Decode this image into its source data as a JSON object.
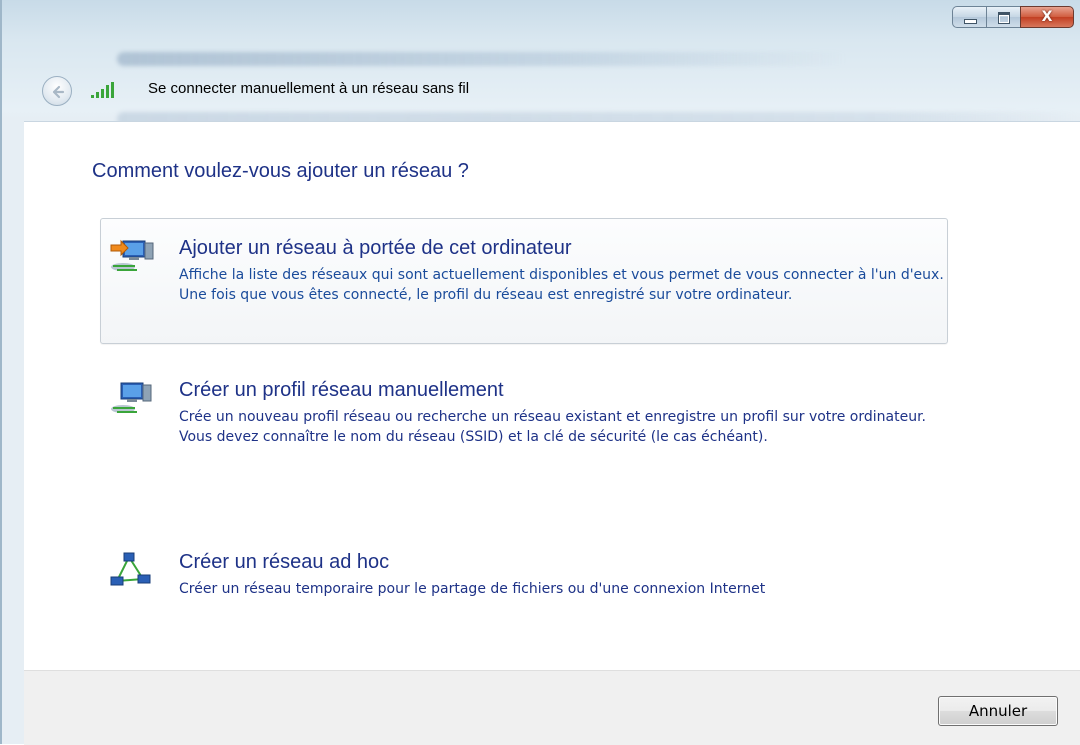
{
  "window": {
    "title": "Se connecter manuellement à un réseau sans fil",
    "controls": [
      "minimize-icon",
      "maximize-icon",
      "close-icon"
    ],
    "close_glyph": "X"
  },
  "main": {
    "heading": "Comment voulez-vous ajouter un réseau ?",
    "options": [
      {
        "title": "Ajouter un réseau à portée de cet ordinateur",
        "description": "Affiche la liste des réseaux qui sont actuellement disponibles et vous permet de vous connecter à l'un d'eux. Une fois que vous êtes connecté, le profil du réseau est enregistré sur votre ordinateur.",
        "icon": "network-arrow-icon"
      },
      {
        "title": "Créer un profil réseau manuellement",
        "description": "Crée un nouveau profil réseau ou recherche un réseau existant et enregistre un profil sur votre ordinateur. Vous devez connaître le nom du réseau (SSID) et la clé de sécurité (le cas échéant).",
        "icon": "network-computer-icon"
      },
      {
        "title": "Créer un réseau ad hoc",
        "description": "Créer un réseau temporaire pour le partage de fichiers ou d'une connexion Internet",
        "icon": "adhoc-network-icon"
      }
    ]
  },
  "footer": {
    "cancel_label": "Annuler"
  },
  "colors": {
    "link_blue": "#1e3287",
    "close_red": "#c23f22",
    "signal_green": "#3aa53a"
  }
}
